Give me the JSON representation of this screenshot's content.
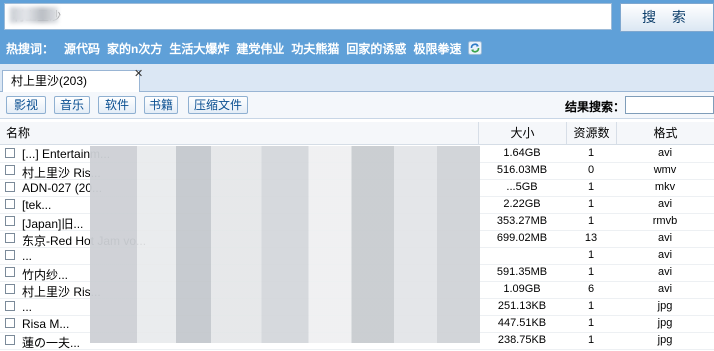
{
  "search": {
    "value": "村上里沙",
    "button": "搜 索"
  },
  "hot": {
    "label": "热搜词：",
    "links": [
      "源代码",
      "家的n次方",
      "生活大爆炸",
      "建党伟业",
      "功夫熊猫",
      "回家的诱惑",
      "极限拳速"
    ]
  },
  "tab": {
    "label": "村上里沙(203)",
    "close": "✕"
  },
  "categories": [
    "影视",
    "音乐",
    "软件",
    "书籍",
    "压缩文件"
  ],
  "result_search": {
    "label": "结果搜索：",
    "value": ""
  },
  "table": {
    "headers": {
      "name": "名称",
      "size": "大小",
      "count": "资源数",
      "format": "格式"
    },
    "rows": [
      {
        "name": "[...] Entertainm...",
        "size": "1.64GB",
        "count": "1",
        "format": "avi"
      },
      {
        "name": "村上里沙 Ris...",
        "size": "516.03MB",
        "count": "0",
        "format": "wmv"
      },
      {
        "name": "ADN-027 (20...",
        "size": "...5GB",
        "count": "1",
        "format": "mkv"
      },
      {
        "name": "[tek...",
        "size": "2.22GB",
        "count": "1",
        "format": "avi"
      },
      {
        "name": "[Japan]旧...",
        "size": "353.27MB",
        "count": "1",
        "format": "rmvb"
      },
      {
        "name": "东京-Red Hot Jam vo...",
        "size": "699.02MB",
        "count": "13",
        "format": "avi"
      },
      {
        "name": "...",
        "size": "",
        "count": "1",
        "format": "avi"
      },
      {
        "name": "竹内纱...",
        "size": "591.35MB",
        "count": "1",
        "format": "avi"
      },
      {
        "name": "村上里沙 Ris...",
        "size": "1.09GB",
        "count": "6",
        "format": "avi"
      },
      {
        "name": "...",
        "size": "251.13KB",
        "count": "1",
        "format": "jpg"
      },
      {
        "name": "Risa M...",
        "size": "447.51KB",
        "count": "1",
        "format": "jpg"
      },
      {
        "name": "蓮の一夫...",
        "size": "238.75KB",
        "count": "1",
        "format": "jpg"
      }
    ]
  }
}
